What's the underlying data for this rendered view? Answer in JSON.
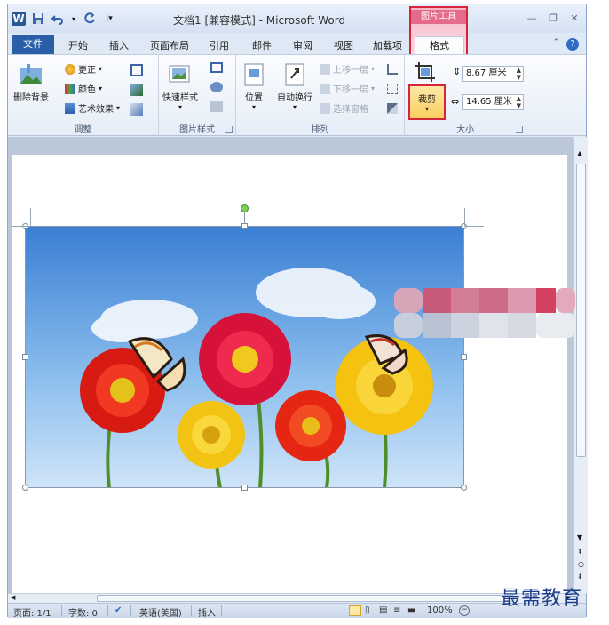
{
  "titlebar": {
    "title": "文档1 [兼容模式] - Microsoft Word",
    "app_icon": "W",
    "context_group": "图片工具"
  },
  "tabs": {
    "file": "文件",
    "items": [
      "开始",
      "插入",
      "页面布局",
      "引用",
      "邮件",
      "审阅",
      "视图",
      "加载项"
    ],
    "active": "格式"
  },
  "ribbon": {
    "adjust": {
      "label": "调整",
      "remove_bg": "删除背景",
      "corrections": "更正",
      "color": "颜色",
      "artistic": "艺术效果"
    },
    "pic_styles": {
      "label": "图片样式",
      "quick_styles": "快速样式"
    },
    "arrange": {
      "label": "排列",
      "position": "位置",
      "wrap": "自动换行",
      "bring_forward": "上移一层",
      "send_backward": "下移一层",
      "selection_pane": "选择窗格"
    },
    "size": {
      "label": "大小",
      "crop": "裁剪",
      "height": "8.67 厘米",
      "width": "14.65 厘米"
    }
  },
  "statusbar": {
    "page": "页面: 1/1",
    "words": "字数: 0",
    "language": "英语(美国)",
    "insert": "插入",
    "zoom": "100%"
  },
  "watermark": "最需教育"
}
